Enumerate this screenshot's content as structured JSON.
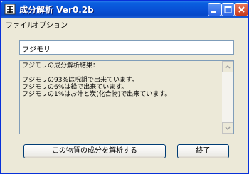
{
  "window": {
    "title": "成分解析 Ver0.2b",
    "icon": "app-icon"
  },
  "titlebar_buttons": {
    "minimize_icon": "minimize-icon",
    "maximize_icon": "maximize-icon",
    "close_icon": "close-icon"
  },
  "menu": {
    "file": "ファイル",
    "options": "オプション"
  },
  "input": {
    "value": "フジモリ"
  },
  "result": {
    "lines": [
      "フジモリの成分解析結果：",
      "",
      "フジモリの93%は呪詛で出来ています。",
      "フジモリの6%は鉛で出来ています。",
      "フジモリの1%はお汁と炭(化合物)で出来ています。"
    ]
  },
  "buttons": {
    "analyze": "この物質の成分を解析する",
    "exit": "終了"
  },
  "colors": {
    "titlebar": "#0850d5",
    "window_bg": "#ece9d8",
    "close_button": "#c9391b"
  }
}
